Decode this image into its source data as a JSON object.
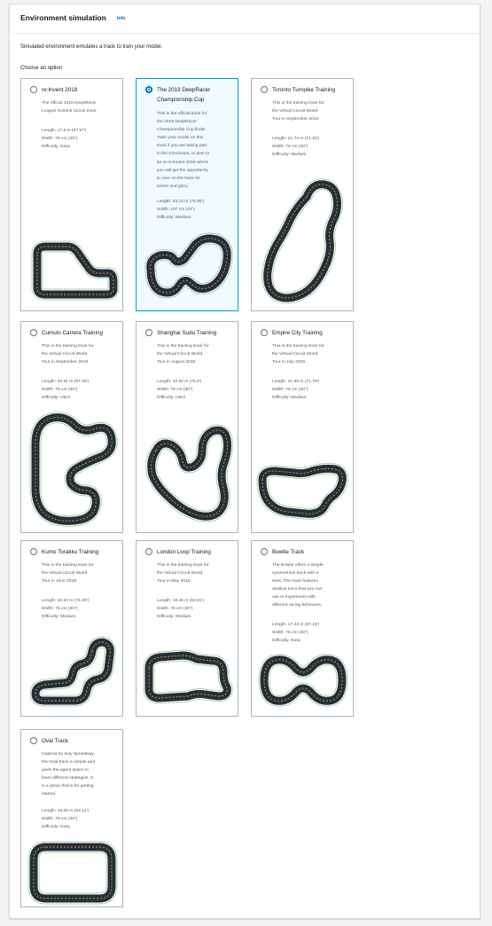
{
  "header": {
    "title": "Environment simulation",
    "info_label": "Info"
  },
  "description": "Simulated environment emulates a track to train your model.",
  "choose_label": "Choose an option",
  "tracks": [
    {
      "name": "re:Invent 2018",
      "selected": false,
      "description": [
        "The official 2018 DeepRacer",
        "League Summit Circuit track."
      ],
      "length": "Length: 17.6 m (57.97')",
      "width": "Width: 76 cm (30\")",
      "difficulty": "Difficulty: Easy"
    },
    {
      "name": "The 2019 DeepRacer Championship Cup",
      "selected": true,
      "description": [
        "This is the official track for",
        "the 2019 DeepRacer",
        "Championship Cup finals.",
        "Train your model on this",
        "track if you are taking part",
        "in the Knockouts, or plan to",
        "be at re:Invent 2019 where",
        "you will get the opportunity",
        "to race on the track for",
        "prizes and glory."
      ],
      "length": "Length: 23.12 m (75.85')",
      "width": "Width: 107 cm (42\")",
      "difficulty": "Difficulty: Medium"
    },
    {
      "name": "Toronto Turnpike Training",
      "selected": false,
      "description": [
        "This is the training track for",
        "the Virtual Circuit World",
        "Tour in September 2019."
      ],
      "length": "Length: 21.74 m (71.33')",
      "width": "Width: 76 cm (30\")",
      "difficulty": "Difficulty: Medium"
    },
    {
      "name": "Cumulo Carrera Training",
      "selected": false,
      "description": [
        "This is the training track for",
        "the Virtual Circuit World",
        "Tour in September 2019."
      ],
      "length": "Length: 20.51 m (67.29')",
      "width": "Width: 76 cm (30\")",
      "difficulty": "Difficulty: Hard"
    },
    {
      "name": "Shanghai Sudu Training",
      "selected": false,
      "description": [
        "This is the training track for",
        "the Virtual Circuit World",
        "Tour in August 2019."
      ],
      "length": "Length: 22.92 m (75.2')",
      "width": "Width: 76 cm (30\")",
      "difficulty": "Difficulty: Hard"
    },
    {
      "name": "Empire City Training",
      "selected": false,
      "description": [
        "This is the training track for",
        "the Virtual Circuit World",
        "Tour in July 2019."
      ],
      "length": "Length: 21.88 m (71.78')",
      "width": "Width: 76 cm (30\")",
      "difficulty": "Difficulty: Medium"
    },
    {
      "name": "Kumo Torakku Training",
      "selected": false,
      "description": [
        "This is the training track for",
        "the Virtual Circuit World",
        "Tour in June 2019."
      ],
      "length": "Length: 22.63 m (74.25')",
      "width": "Width: 76 cm (30\")",
      "difficulty": "Difficulty: Medium"
    },
    {
      "name": "London Loop Training",
      "selected": false,
      "description": [
        "This is the training track for",
        "the Virtual Circuit World",
        "Tour in May 2019."
      ],
      "length": "Length: 19.45 m (63.81')",
      "width": "Width: 76 cm (30\")",
      "difficulty": "Difficulty: Medium"
    },
    {
      "name": "Bowtie Track",
      "selected": false,
      "description": [
        "The Bowtie offers a simple",
        "symmetrical track with a",
        "twist. The track features",
        "shallow turns that you can",
        "use to experiment with",
        "different racing behaviors."
      ],
      "length": "Length: 17.43 m (57.19')",
      "width": "Width: 76 cm (30\")",
      "difficulty": "Difficulty: Easy"
    },
    {
      "name": "Oval Track",
      "selected": false,
      "description": [
        "Inspired by Indy Speedway,",
        "the Oval track is simple and",
        "gives the agent space to",
        "learn different strategies. It",
        "is a good choice for getting",
        "started."
      ],
      "length": "Length: 19.55 m (64.14')",
      "width": "Width: 76 cm (30\")",
      "difficulty": "Difficulty: Easy"
    }
  ],
  "colors": {
    "accent": "#0073bb",
    "selected_border": "#00a1c9",
    "selected_bg": "#f1faff",
    "track_asphalt": "#232f3e",
    "track_center_line": "#ff9900",
    "track_edge": "#1d8102"
  }
}
